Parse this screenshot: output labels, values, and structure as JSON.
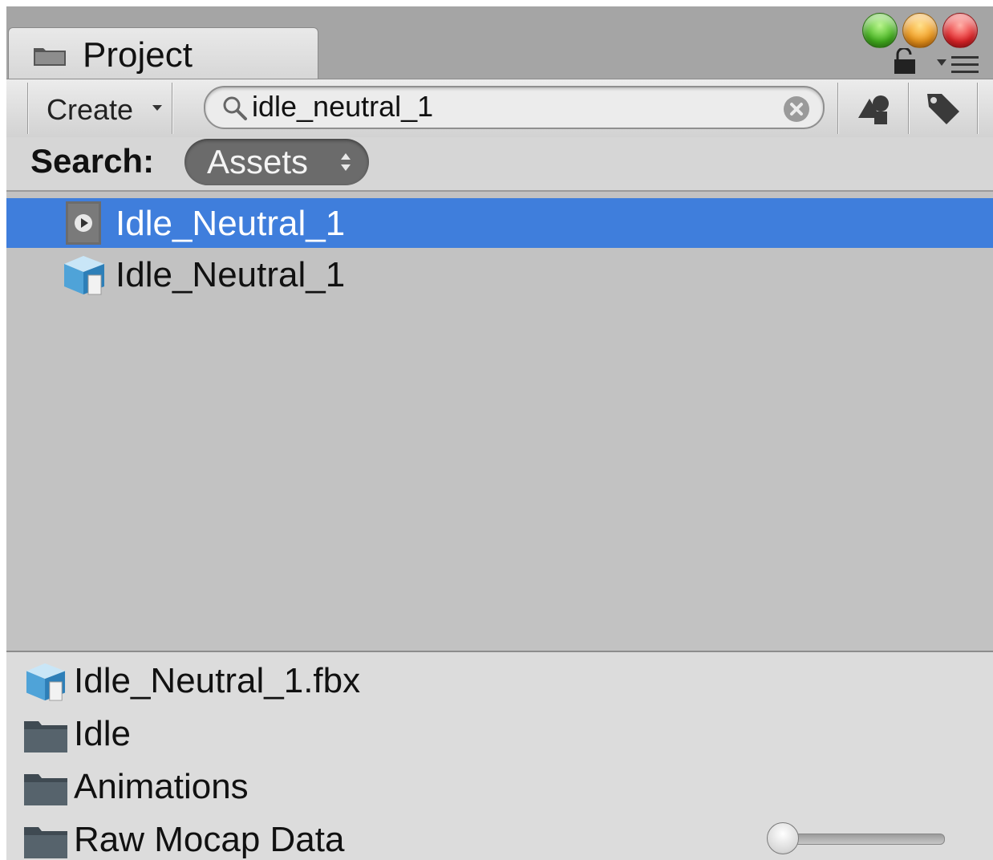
{
  "window": {
    "tab_label": "Project",
    "tab_icon": "folder-icon",
    "controls": [
      "green-zoom-button",
      "orange-minimize-button",
      "red-close-button"
    ],
    "colors": {
      "selection": "#3f7edc",
      "results_bg": "#c2c2c2",
      "panel_bg": "#dcdcdc"
    }
  },
  "toolbar": {
    "create_label": "Create",
    "search": {
      "value": "idle_neutral_1",
      "placeholder": ""
    },
    "buttons": [
      "search-by-type-icon",
      "search-by-label-icon"
    ]
  },
  "scope": {
    "label": "Search:",
    "value": "Assets"
  },
  "results": [
    {
      "label": "Idle_Neutral_1",
      "icon": "animation-clip-icon",
      "selected": true
    },
    {
      "label": "Idle_Neutral_1",
      "icon": "model-icon",
      "selected": false
    }
  ],
  "path": [
    {
      "label": "Idle_Neutral_1.fbx",
      "icon": "model-icon"
    },
    {
      "label": "Idle",
      "icon": "folder-icon"
    },
    {
      "label": "Animations",
      "icon": "folder-icon"
    },
    {
      "label": "Raw Mocap Data",
      "icon": "folder-icon"
    }
  ],
  "icon_size_slider": {
    "value": 0.0
  }
}
